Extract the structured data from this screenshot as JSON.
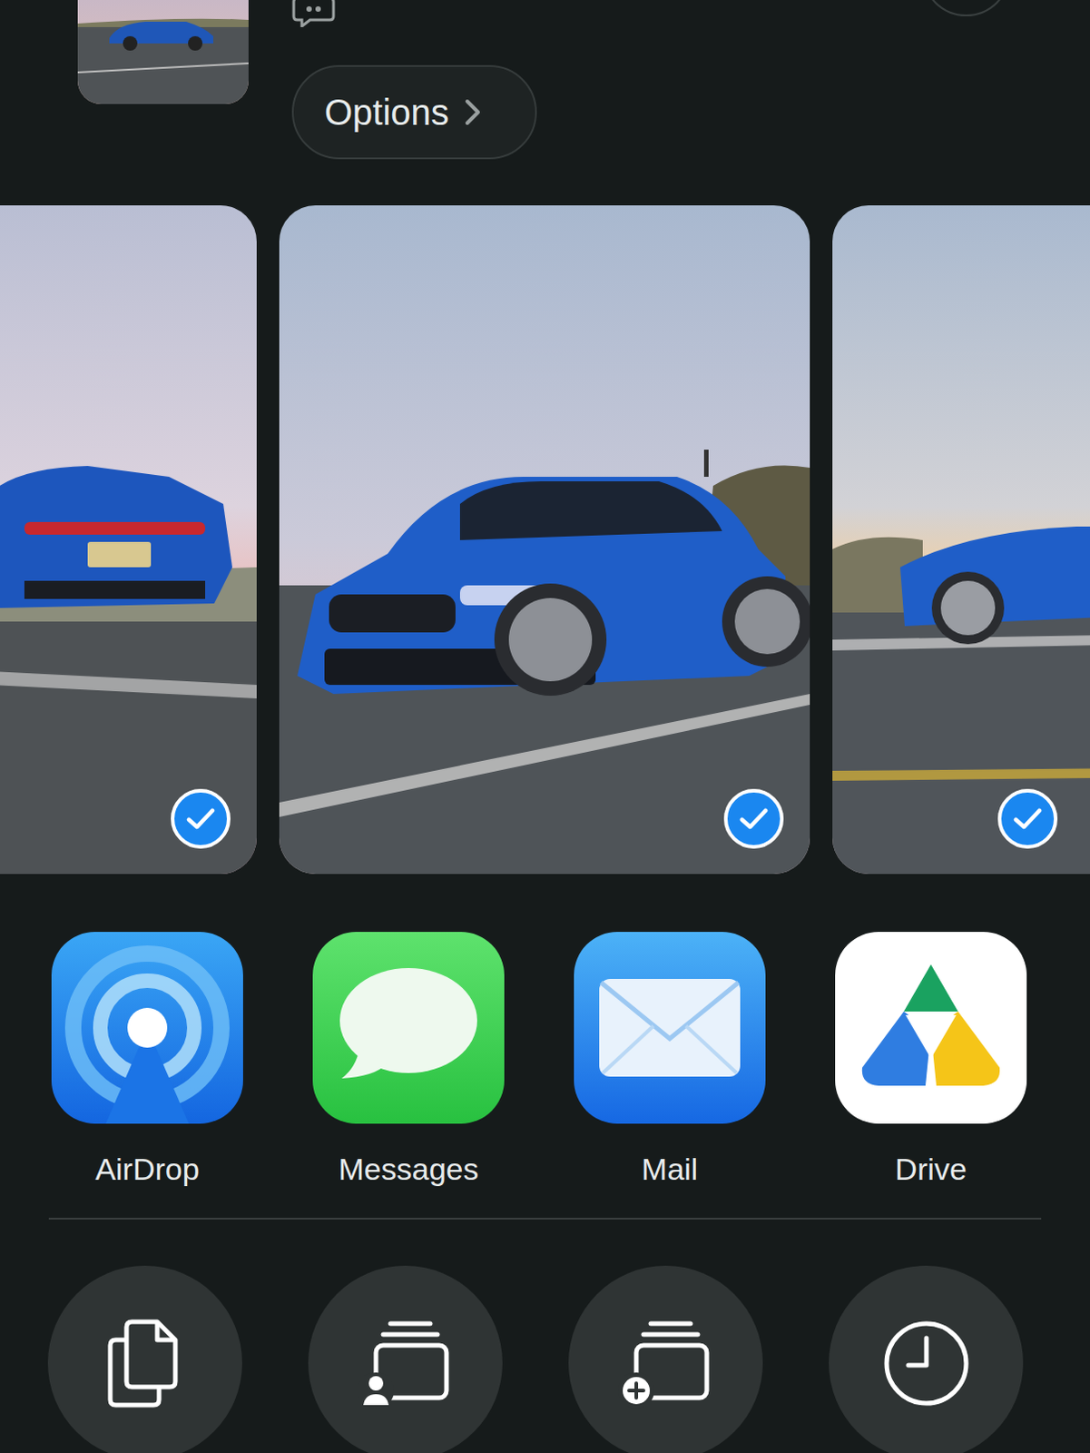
{
  "share_header": {
    "options_label": "Options"
  },
  "photos": [
    {
      "selected": true
    },
    {
      "selected": true
    },
    {
      "selected": true
    }
  ],
  "apps": [
    {
      "label": "AirDrop"
    },
    {
      "label": "Messages"
    },
    {
      "label": "Mail"
    },
    {
      "label": "Drive"
    }
  ]
}
